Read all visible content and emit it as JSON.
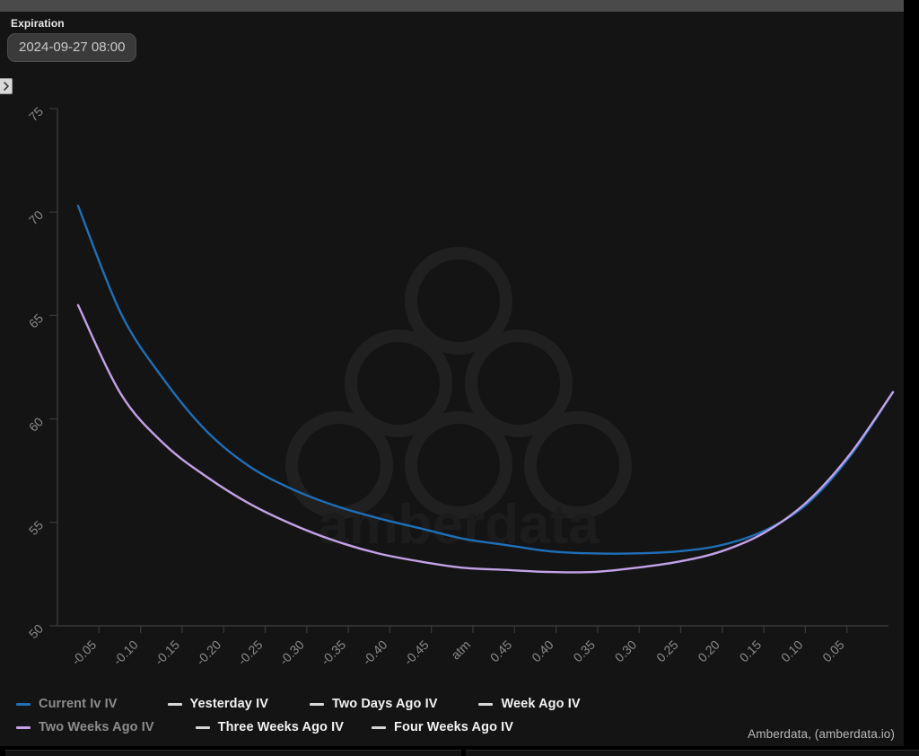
{
  "window": {
    "titlebar_color": "#4a4a4a",
    "background": "#000000",
    "panel_background": "#141414"
  },
  "controls": {
    "expiration_label": "Expiration",
    "expiration_value": "2024-09-27 08:00",
    "collapse_icon": "chevron-right-icon"
  },
  "watermark": {
    "brand_text": "amberdata",
    "logo_icon": "amberdata-logo-icon"
  },
  "attribution": "Amberdata, (amberdata.io)",
  "legend": {
    "rows": [
      [
        {
          "label": "Current Iv IV",
          "color": "#1f6fb8",
          "active": false
        },
        {
          "label": "Yesterday IV",
          "color": "#d8d8d8",
          "active": true
        },
        {
          "label": "Two Days Ago IV",
          "color": "#d8d8d8",
          "active": true
        },
        {
          "label": "Week Ago IV",
          "color": "#d8d8d8",
          "active": true
        }
      ],
      [
        {
          "label": "Two Weeks Ago IV",
          "color": "#c3a2e8",
          "active": false
        },
        {
          "label": "Three Weeks Ago IV",
          "color": "#d8d8d8",
          "active": true
        },
        {
          "label": "Four Weeks Ago IV",
          "color": "#d8d8d8",
          "active": true
        }
      ]
    ]
  },
  "chart_data": {
    "type": "line",
    "title": "",
    "xlabel": "",
    "ylabel": "",
    "grid": false,
    "legend_position": "bottom",
    "ylim": [
      50,
      75
    ],
    "yticks": [
      50,
      55,
      60,
      65,
      70,
      75
    ],
    "ytick_labels": [
      "50",
      "55",
      "60",
      "65",
      "70",
      "75"
    ],
    "xticks": [
      "-0.05",
      "-0.10",
      "-0.15",
      "-0.20",
      "-0.25",
      "-0.30",
      "-0.35",
      "-0.40",
      "-0.45",
      "atm",
      "0.45",
      "0.40",
      "0.35",
      "0.30",
      "0.25",
      "0.20",
      "0.15",
      "0.10",
      "0.05"
    ],
    "x": [
      "-0.05",
      "-0.10",
      "-0.15",
      "-0.20",
      "-0.25",
      "-0.30",
      "-0.35",
      "-0.40",
      "-0.45",
      "atm",
      "0.45",
      "0.40",
      "0.35",
      "0.30",
      "0.25",
      "0.20",
      "0.15",
      "0.10",
      "0.05"
    ],
    "series": [
      {
        "name": "Current Iv IV",
        "color": "#1f6fb8",
        "values": [
          70.3,
          65.1,
          61.9,
          59.4,
          57.7,
          56.6,
          55.8,
          55.2,
          54.7,
          54.2,
          53.9,
          53.6,
          53.5,
          53.5,
          53.6,
          53.9,
          54.6,
          55.9,
          58.2,
          61.3
        ]
      },
      {
        "name": "Two Weeks Ago IV",
        "color": "#c3a2e8",
        "values": [
          65.5,
          61.2,
          58.8,
          57.2,
          55.9,
          54.9,
          54.1,
          53.5,
          53.1,
          52.8,
          52.7,
          52.6,
          52.6,
          52.8,
          53.1,
          53.6,
          54.5,
          56.0,
          58.3,
          61.3
        ]
      }
    ]
  }
}
